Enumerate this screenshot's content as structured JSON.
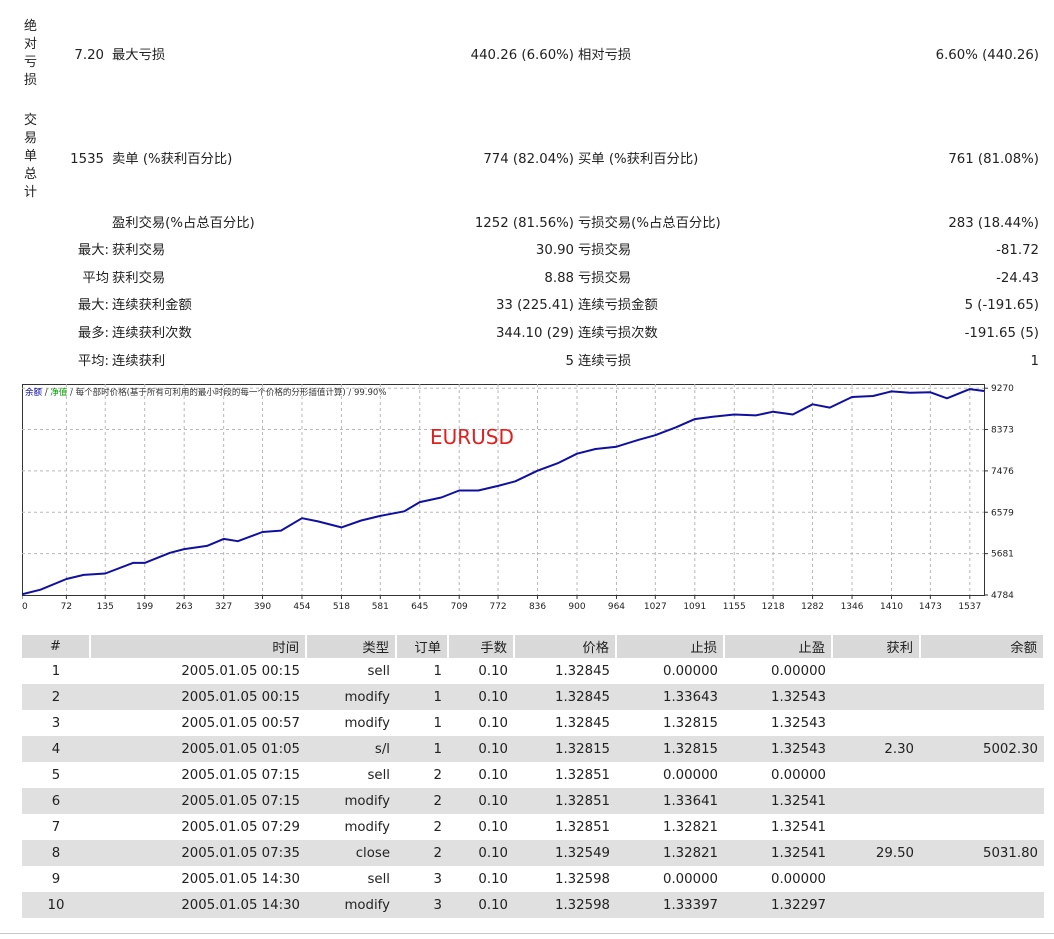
{
  "summary": {
    "abs_dd": {
      "label": "绝对亏损",
      "value": "7.20",
      "max_label": "最大亏损",
      "max_value": "440.26 (6.60%)",
      "rel_label": "相对亏损",
      "rel_value": "6.60% (440.26)"
    },
    "trades": {
      "label": "交易单总计",
      "value": "1535",
      "short_label": "卖单 (%获利百分比)",
      "short_value": "774 (82.04%)",
      "long_label": "买单 (%获利百分比)",
      "long_value": "761 (81.08%)"
    },
    "profit_row": {
      "win_label": "盈利交易(%占总百分比)",
      "win_value": "1252 (81.56%)",
      "loss_label": "亏损交易(%占总百分比)",
      "loss_value": "283 (18.44%)"
    },
    "largest": {
      "prefix": "最大:",
      "win_label": "获利交易",
      "win_value": "30.90",
      "loss_label": "亏损交易",
      "loss_value": "-81.72"
    },
    "average": {
      "prefix": "平均",
      "win_label": "获利交易",
      "win_value": "8.88",
      "loss_label": "亏损交易",
      "loss_value": "-24.43"
    },
    "max_consec": {
      "prefix": "最大:",
      "win_label": "连续获利金额",
      "win_value": "33 (225.41)",
      "loss_label": "连续亏损金额",
      "loss_value": "5 (-191.65)"
    },
    "most_consec": {
      "prefix": "最多:",
      "win_label": "连续获利次数",
      "win_value": "344.10 (29)",
      "loss_label": "连续亏损次数",
      "loss_value": "-191.65 (5)"
    },
    "avg_consec": {
      "prefix": "平均:",
      "win_label": "连续获利",
      "win_value": "5",
      "loss_label": "连续亏损",
      "loss_value": "1"
    }
  },
  "chart_data": {
    "type": "line",
    "legend": {
      "balance": "余额",
      "sep1": " / ",
      "equity": "净值",
      "sep2": " / ",
      "note": "每个部时价格(基于所有可利用的最小时段的每一个价格的分形插值计算) / 99.90%"
    },
    "symbol_label": "EURUSD",
    "symbol_color": "#e02020",
    "line_color": "#1010a0",
    "x_ticks": [
      0,
      72,
      135,
      199,
      263,
      327,
      390,
      454,
      518,
      581,
      645,
      709,
      772,
      836,
      900,
      964,
      1027,
      1091,
      1155,
      1218,
      1282,
      1346,
      1410,
      1473,
      1537
    ],
    "y_ticks": [
      4784,
      5681,
      6579,
      7476,
      8373,
      9270
    ],
    "xlim": [
      0,
      1560
    ],
    "ylim": [
      4784,
      9361
    ],
    "grid": true,
    "series": [
      {
        "x": [
          0,
          30,
          72,
          100,
          135,
          180,
          199,
          240,
          263,
          300,
          327,
          350,
          390,
          420,
          454,
          480,
          518,
          550,
          581,
          620,
          645,
          680,
          709,
          740,
          772,
          800,
          836,
          870,
          900,
          930,
          964,
          1000,
          1027,
          1060,
          1091,
          1120,
          1155,
          1190,
          1218,
          1250,
          1282,
          1310,
          1346,
          1380,
          1410,
          1440,
          1473,
          1500,
          1537,
          1560
        ],
        "y": [
          4800,
          4900,
          5130,
          5220,
          5250,
          5480,
          5480,
          5700,
          5780,
          5850,
          6000,
          5950,
          6150,
          6180,
          6450,
          6380,
          6250,
          6400,
          6500,
          6600,
          6800,
          6900,
          7050,
          7050,
          7150,
          7250,
          7480,
          7650,
          7850,
          7950,
          8000,
          8150,
          8250,
          8420,
          8600,
          8650,
          8700,
          8680,
          8760,
          8700,
          8920,
          8850,
          9080,
          9100,
          9200,
          9170,
          9180,
          9050,
          9250,
          9210
        ]
      }
    ]
  },
  "table": {
    "headers": [
      "#",
      "时间",
      "类型",
      "订单",
      "手数",
      "价格",
      "止损",
      "止盈",
      "获利",
      "余额"
    ],
    "rows": [
      [
        "1",
        "2005.01.05 00:15",
        "sell",
        "1",
        "0.10",
        "1.32845",
        "0.00000",
        "0.00000",
        "",
        ""
      ],
      [
        "2",
        "2005.01.05 00:15",
        "modify",
        "1",
        "0.10",
        "1.32845",
        "1.33643",
        "1.32543",
        "",
        ""
      ],
      [
        "3",
        "2005.01.05 00:57",
        "modify",
        "1",
        "0.10",
        "1.32845",
        "1.32815",
        "1.32543",
        "",
        ""
      ],
      [
        "4",
        "2005.01.05 01:05",
        "s/l",
        "1",
        "0.10",
        "1.32815",
        "1.32815",
        "1.32543",
        "2.30",
        "5002.30"
      ],
      [
        "5",
        "2005.01.05 07:15",
        "sell",
        "2",
        "0.10",
        "1.32851",
        "0.00000",
        "0.00000",
        "",
        ""
      ],
      [
        "6",
        "2005.01.05 07:15",
        "modify",
        "2",
        "0.10",
        "1.32851",
        "1.33641",
        "1.32541",
        "",
        ""
      ],
      [
        "7",
        "2005.01.05 07:29",
        "modify",
        "2",
        "0.10",
        "1.32851",
        "1.32821",
        "1.32541",
        "",
        ""
      ],
      [
        "8",
        "2005.01.05 07:35",
        "close",
        "2",
        "0.10",
        "1.32549",
        "1.32821",
        "1.32541",
        "29.50",
        "5031.80"
      ],
      [
        "9",
        "2005.01.05 14:30",
        "sell",
        "3",
        "0.10",
        "1.32598",
        "0.00000",
        "0.00000",
        "",
        ""
      ],
      [
        "10",
        "2005.01.05 14:30",
        "modify",
        "3",
        "0.10",
        "1.32598",
        "1.33397",
        "1.32297",
        "",
        ""
      ]
    ]
  }
}
